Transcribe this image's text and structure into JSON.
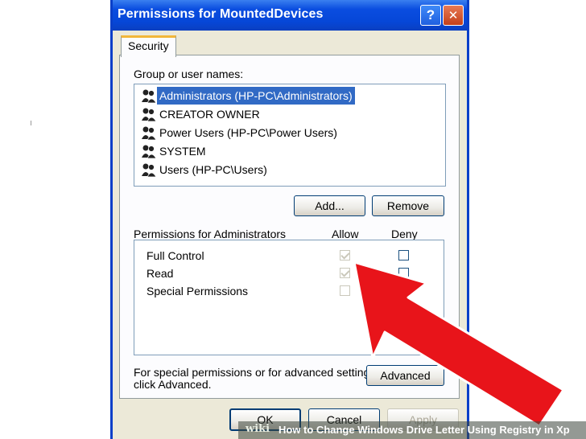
{
  "window": {
    "title": "Permissions for MountedDevices",
    "help_glyph": "?",
    "close_glyph": "✕"
  },
  "tabs": [
    {
      "label": "Security"
    }
  ],
  "group_label": "Group or user names:",
  "users": [
    {
      "name": "Administrators (HP-PC\\Administrators)"
    },
    {
      "name": "CREATOR OWNER"
    },
    {
      "name": "Power Users (HP-PC\\Power Users)"
    },
    {
      "name": "SYSTEM"
    },
    {
      "name": "Users (HP-PC\\Users)"
    }
  ],
  "buttons": {
    "add": "Add...",
    "remove": "Remove",
    "advanced": "Advanced",
    "ok": "OK",
    "cancel": "Cancel",
    "apply": "Apply"
  },
  "permissions": {
    "header": "Permissions for Administrators",
    "allow_label": "Allow",
    "deny_label": "Deny",
    "rows": [
      {
        "name": "Full Control",
        "allow": true,
        "deny": false
      },
      {
        "name": "Read",
        "allow": true,
        "deny": false
      },
      {
        "name": "Special Permissions",
        "allow": false,
        "deny": false
      }
    ]
  },
  "advanced_note": {
    "line1": "For special permissions or for advanced settings,",
    "line2": "click Advanced."
  },
  "watermark": {
    "brand": "wiki",
    "text": "How to Change Windows Drive Letter Using Registry in Xp"
  },
  "colors": {
    "title_bar": "#0a4de0",
    "selection": "#316ac5",
    "arrow": "#e8141a",
    "dialog_bg": "#ece9d8"
  }
}
